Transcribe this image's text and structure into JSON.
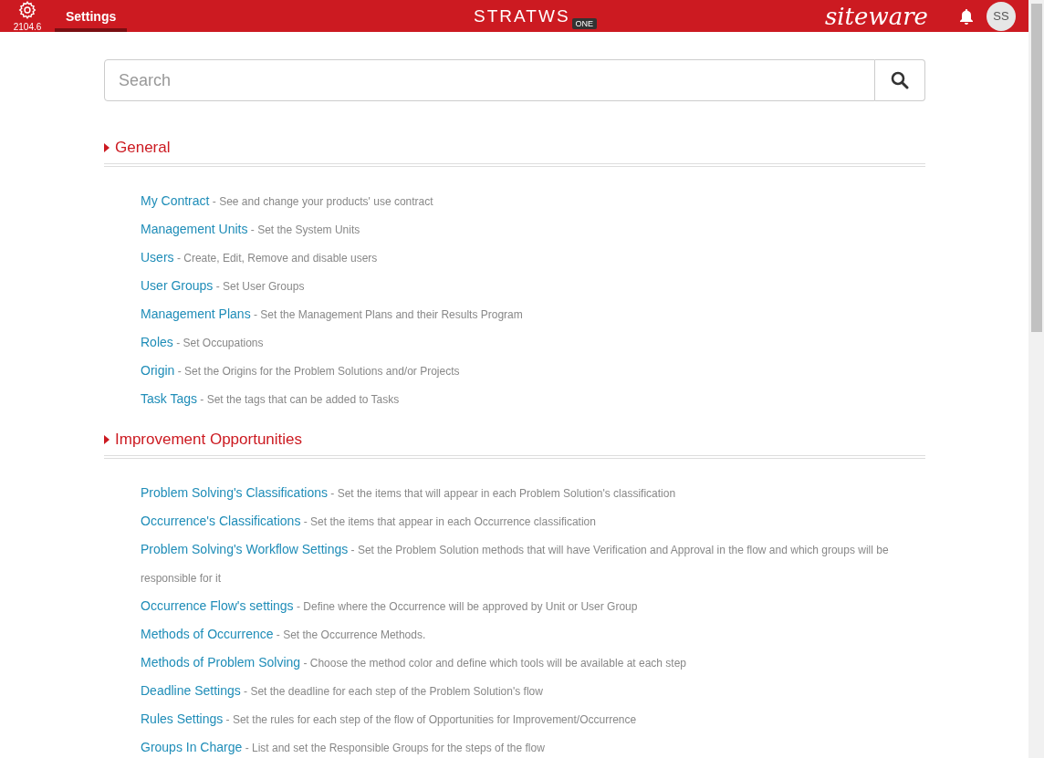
{
  "header": {
    "version": "2104.6",
    "tabs": [
      {
        "label": "Settings",
        "selected": true
      }
    ],
    "logo": {
      "name": "STRATWS",
      "badge": "ONE"
    },
    "brand": "siteware",
    "avatar": "SS"
  },
  "search": {
    "placeholder": "Search"
  },
  "sections": [
    {
      "title": "General",
      "expanded": true,
      "items": [
        {
          "label": "My Contract",
          "description": "- See and change your products' use contract"
        },
        {
          "label": "Management Units",
          "description": "- Set the System Units"
        },
        {
          "label": "Users",
          "description": "- Create, Edit, Remove and disable users"
        },
        {
          "label": "User Groups",
          "description": "- Set User Groups"
        },
        {
          "label": "Management Plans",
          "description": "- Set the Management Plans and their Results Program"
        },
        {
          "label": "Roles",
          "description": "- Set Occupations"
        },
        {
          "label": "Origin",
          "description": "- Set the Origins for the Problem Solutions and/or Projects"
        },
        {
          "label": "Task Tags",
          "description": "- Set the tags that can be added to Tasks"
        }
      ]
    },
    {
      "title": "Improvement Opportunities",
      "expanded": true,
      "items": [
        {
          "label": "Problem Solving's Classifications",
          "description": "- Set the items that will appear in each Problem Solution's classification"
        },
        {
          "label": "Occurrence's Classifications",
          "description": "- Set the items that appear in each Occurrence classification"
        },
        {
          "label": "Problem Solving's Workflow Settings",
          "description": "- Set the Problem Solution methods that will have Verification and Approval in the flow and which groups will be responsible for it"
        },
        {
          "label": "Occurrence Flow's settings",
          "description": "- Define where the Occurrence will be approved by Unit or User Group"
        },
        {
          "label": "Methods of Occurrence",
          "description": "- Set the Occurrence Methods."
        },
        {
          "label": "Methods of Problem Solving",
          "description": "- Choose the method color and define which tools will be available at each step"
        },
        {
          "label": "Deadline Settings",
          "description": "- Set the deadline for each step of the Problem Solution's flow"
        },
        {
          "label": "Rules Settings",
          "description": "- Set the rules for each step of the flow of Opportunities for Improvement/Occurrence"
        },
        {
          "label": "Groups In Charge",
          "description": "- List and set the Responsible Groups for the steps of the flow"
        }
      ]
    }
  ]
}
